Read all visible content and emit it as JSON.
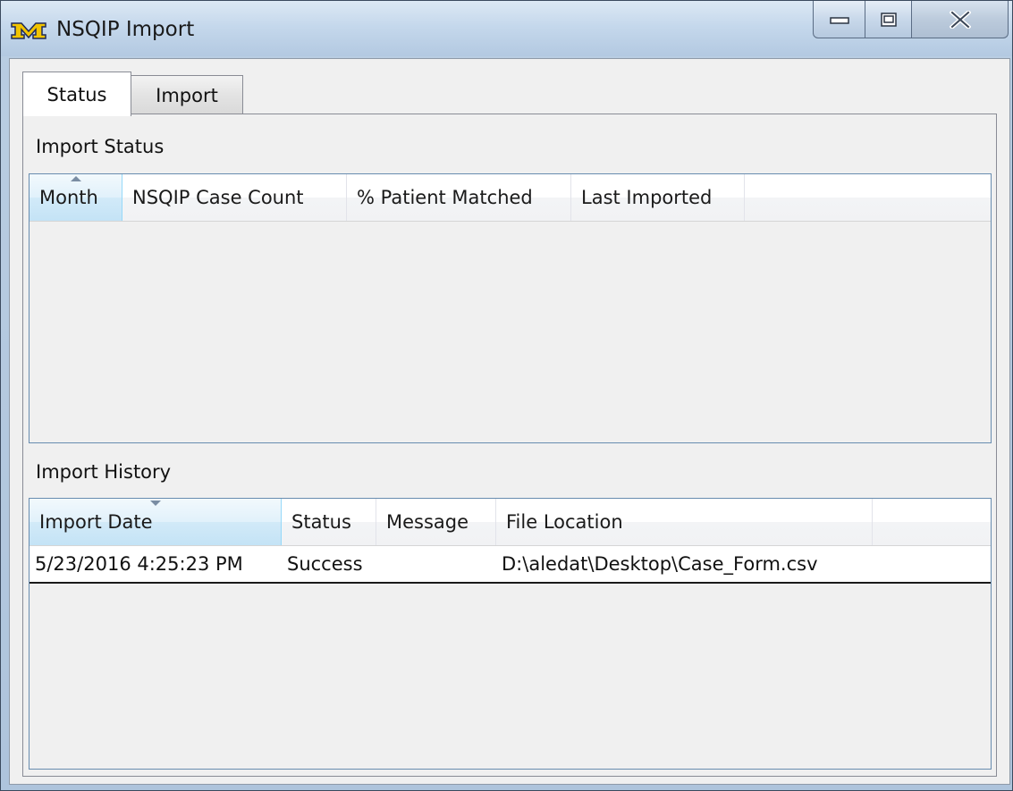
{
  "window": {
    "title": "NSQIP Import",
    "icon": "m-logo-icon",
    "icon_letter": "M",
    "icon_color": "#8a6d00",
    "controls": {
      "minimize": "minimize-icon",
      "maximize": "maximize-icon",
      "close": "close-icon"
    }
  },
  "tabs": [
    {
      "label": "Status",
      "active": true
    },
    {
      "label": "Import",
      "active": false
    }
  ],
  "import_status": {
    "label": "Import Status",
    "columns": [
      "Month",
      "NSQIP Case Count",
      "% Patient Matched",
      "Last Imported"
    ],
    "sorted_column": "Month",
    "sort_direction": "ascending",
    "rows": []
  },
  "import_history": {
    "label": "Import History",
    "columns": [
      "Import Date",
      "Status",
      "Message",
      "File Location"
    ],
    "sorted_column": "Import Date",
    "sort_direction": "descending",
    "rows": [
      {
        "import_date": "5/23/2016 4:25:23 PM",
        "status": "Success",
        "message": "",
        "file_location": "D:\\aledat\\Desktop\\Case_Form.csv"
      }
    ]
  },
  "colors": {
    "grid_border": "#688caf",
    "sorted_header": "#c4e3f6",
    "panel_bg": "#f0f0f0"
  }
}
